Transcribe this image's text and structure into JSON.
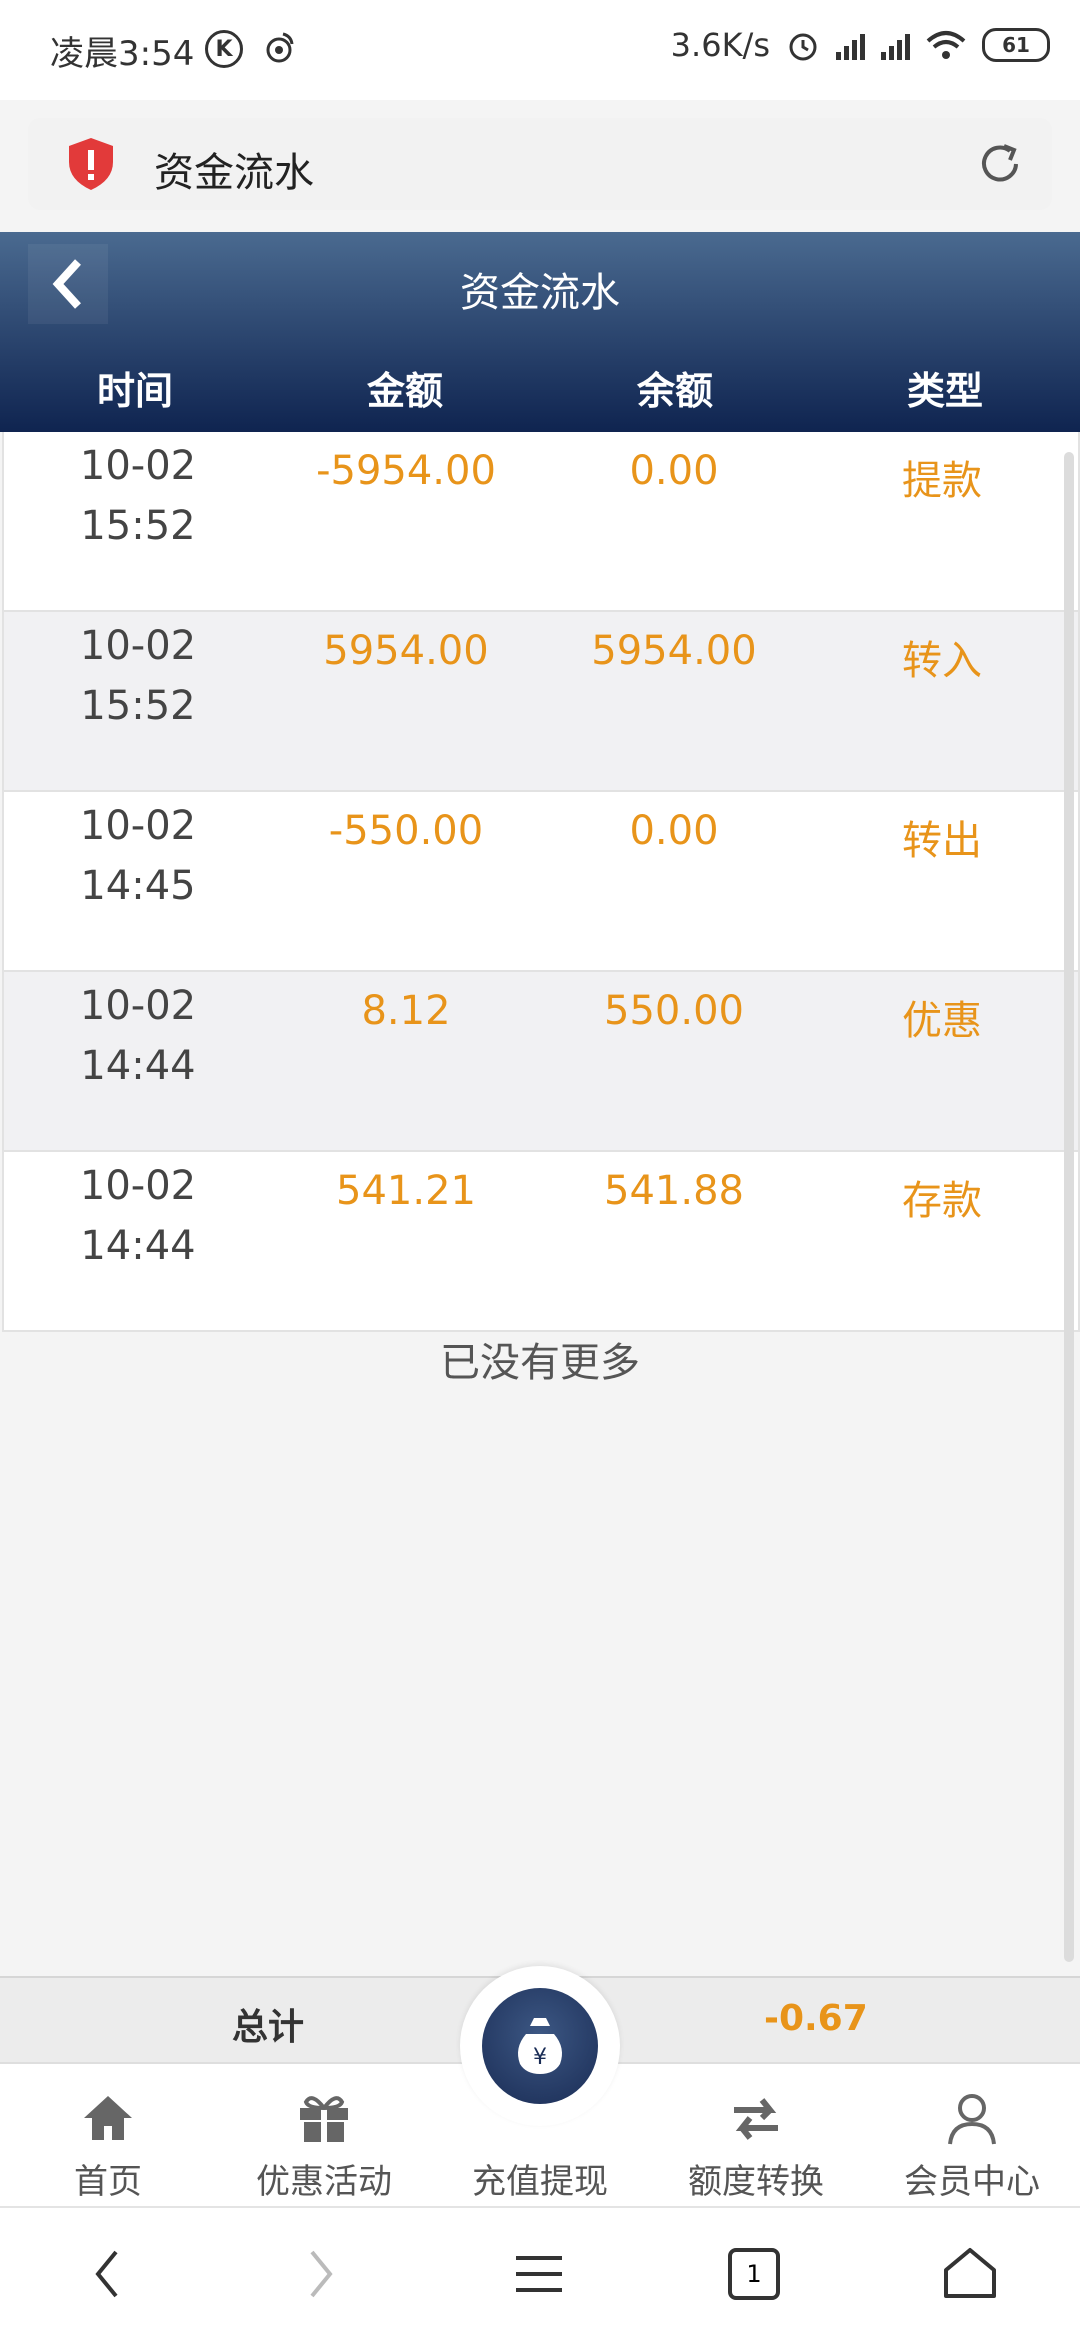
{
  "status_bar": {
    "time": "凌晨3:54",
    "net_speed": "3.6K/s",
    "battery": "61",
    "k_glyph": "K"
  },
  "address_bar": {
    "text": "资金流水"
  },
  "header": {
    "title": "资金流水",
    "columns": [
      "时间",
      "金额",
      "余额",
      "类型"
    ]
  },
  "rows": [
    {
      "date": "10-02",
      "time": "15:52",
      "amount": "-5954.00",
      "balance": "0.00",
      "type": "提款"
    },
    {
      "date": "10-02",
      "time": "15:52",
      "amount": "5954.00",
      "balance": "5954.00",
      "type": "转入"
    },
    {
      "date": "10-02",
      "time": "14:45",
      "amount": "-550.00",
      "balance": "0.00",
      "type": "转出"
    },
    {
      "date": "10-02",
      "time": "14:44",
      "amount": "8.12",
      "balance": "550.00",
      "type": "优惠"
    },
    {
      "date": "10-02",
      "time": "14:44",
      "amount": "541.21",
      "balance": "541.88",
      "type": "存款"
    }
  ],
  "no_more_text": "已没有更多",
  "totals": {
    "label": "总计",
    "value": "-0.67"
  },
  "tabs": [
    {
      "label": "首页",
      "icon": "home-icon"
    },
    {
      "label": "优惠活动",
      "icon": "gift-icon"
    },
    {
      "label": "充值提现",
      "icon": "money-bag-icon"
    },
    {
      "label": "额度转换",
      "icon": "transfer-arrows-icon"
    },
    {
      "label": "会员中心",
      "icon": "user-icon"
    }
  ],
  "money_bag_symbol": "¥",
  "nav": {
    "tab_count": "1"
  },
  "colors": {
    "accent": "#e8941a",
    "header_top": "#4a6a90",
    "header_bottom": "#0f2450"
  }
}
